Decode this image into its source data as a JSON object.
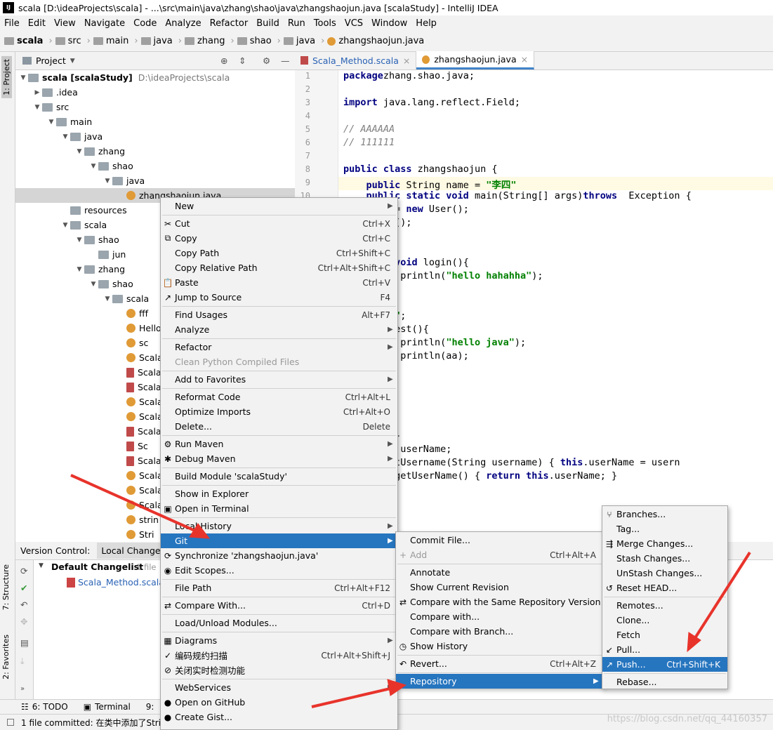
{
  "window": {
    "title": "scala [D:\\ideaProjects\\scala] - ...\\src\\main\\java\\zhang\\shao\\java\\zhangshaojun.java [scalaStudy] - IntelliJ IDEA"
  },
  "menubar": [
    "File",
    "Edit",
    "View",
    "Navigate",
    "Code",
    "Analyze",
    "Refactor",
    "Build",
    "Run",
    "Tools",
    "VCS",
    "Window",
    "Help"
  ],
  "breadcrumb": [
    "scala",
    "src",
    "main",
    "java",
    "zhang",
    "shao",
    "java",
    "zhangshaojun.java"
  ],
  "left_tools": {
    "project": "1: Project",
    "structure": "7: Structure",
    "favorites": "2: Favorites"
  },
  "project_panel": {
    "title": "Project",
    "tree": [
      {
        "label": "scala [scalaStudy]",
        "extra": "D:\\ideaProjects\\scala",
        "indent": 0,
        "chev": "down",
        "icon": "folder"
      },
      {
        "label": ".idea",
        "indent": 1,
        "chev": "right",
        "icon": "folder"
      },
      {
        "label": "src",
        "indent": 1,
        "chev": "down",
        "icon": "folder"
      },
      {
        "label": "main",
        "indent": 2,
        "chev": "down",
        "icon": "folder"
      },
      {
        "label": "java",
        "indent": 3,
        "chev": "down",
        "icon": "folder"
      },
      {
        "label": "zhang",
        "indent": 4,
        "chev": "down",
        "icon": "folder"
      },
      {
        "label": "shao",
        "indent": 5,
        "chev": "down",
        "icon": "folder"
      },
      {
        "label": "java",
        "indent": 6,
        "chev": "down",
        "icon": "folder"
      },
      {
        "label": "zhangshaojun.java",
        "indent": 7,
        "chev": "",
        "icon": "class",
        "selected": true
      },
      {
        "label": "resources",
        "indent": 3,
        "chev": "",
        "icon": "folder"
      },
      {
        "label": "scala",
        "indent": 3,
        "chev": "down",
        "icon": "folder"
      },
      {
        "label": "shao",
        "indent": 4,
        "chev": "down",
        "icon": "folder"
      },
      {
        "label": "jun",
        "indent": 5,
        "chev": "",
        "icon": "folder"
      },
      {
        "label": "zhang",
        "indent": 4,
        "chev": "down",
        "icon": "folder"
      },
      {
        "label": "shao",
        "indent": 5,
        "chev": "down",
        "icon": "folder"
      },
      {
        "label": "scala",
        "indent": 6,
        "chev": "down",
        "icon": "folder"
      },
      {
        "label": "fff",
        "indent": 7,
        "chev": "",
        "icon": "class"
      },
      {
        "label": "Hello",
        "indent": 7,
        "chev": "",
        "icon": "class"
      },
      {
        "label": "sc",
        "indent": 7,
        "chev": "",
        "icon": "class"
      },
      {
        "label": "Scala",
        "indent": 7,
        "chev": "",
        "icon": "class"
      },
      {
        "label": "Scala",
        "indent": 7,
        "chev": "",
        "icon": "file"
      },
      {
        "label": "Scala",
        "indent": 7,
        "chev": "",
        "icon": "file"
      },
      {
        "label": "Scala",
        "indent": 7,
        "chev": "",
        "icon": "class"
      },
      {
        "label": "Scala",
        "indent": 7,
        "chev": "",
        "icon": "class"
      },
      {
        "label": "Scala",
        "indent": 7,
        "chev": "",
        "icon": "file"
      },
      {
        "label": "Sc",
        "indent": 7,
        "chev": "",
        "icon": "file"
      },
      {
        "label": "Scala",
        "indent": 7,
        "chev": "",
        "icon": "file"
      },
      {
        "label": "Scala",
        "indent": 7,
        "chev": "",
        "icon": "class"
      },
      {
        "label": "Scala",
        "indent": 7,
        "chev": "",
        "icon": "class"
      },
      {
        "label": "Scala",
        "indent": 7,
        "chev": "",
        "icon": "class"
      },
      {
        "label": "strin",
        "indent": 7,
        "chev": "",
        "icon": "class"
      },
      {
        "label": "Stri",
        "indent": 7,
        "chev": "",
        "icon": "class"
      }
    ]
  },
  "editor": {
    "tabs": [
      {
        "label": "Scala_Method.scala",
        "active": false
      },
      {
        "label": "zhangshaojun.java",
        "active": true
      }
    ],
    "line_numbers": [
      "1",
      "2",
      "3",
      "4",
      "5",
      "6",
      "7",
      "8",
      "9",
      "10"
    ],
    "lines": [
      [
        [
          "kw",
          "package"
        ],
        [
          "",
          "zhang.shao.java;"
        ]
      ],
      [],
      [
        [
          "kw",
          "import"
        ],
        [
          "",
          " java.lang.reflect.Field;"
        ]
      ],
      [],
      [
        [
          "cmt",
          "// AAAAAA"
        ]
      ],
      [
        [
          "cmt",
          "// 111111"
        ]
      ],
      [],
      [
        [
          "kw",
          "public class"
        ],
        [
          "",
          " zhangshaojun {"
        ]
      ],
      [
        [
          "",
          ""
        ],
        [
          "kw",
          "    public"
        ],
        [
          "",
          " String name = "
        ],
        [
          "str",
          "\"李四\""
        ]
      ],
      [
        [
          "kw",
          "    public static void"
        ],
        [
          "",
          " main(String[] args)"
        ],
        [
          "kw",
          "throws"
        ],
        [
          "",
          "  Exception {"
        ]
      ],
      [
        [
          "",
          "ser user = "
        ],
        [
          "kw",
          "new"
        ],
        [
          "",
          " User();"
        ]
      ],
      [
        [
          "",
          "ser.clone();"
        ]
      ],
      [],
      [],
      [
        [
          "kw",
          "c static void"
        ],
        [
          "",
          " login(){"
        ]
      ],
      [
        [
          "",
          "ystem.out.println("
        ],
        [
          "str",
          "\"hello hahahha\""
        ],
        [
          "",
          ");"
        ]
      ],
      [],
      [],
      [
        [
          "",
          "g aa= "
        ],
        [
          "str",
          "\"10\""
        ],
        [
          "",
          ";"
        ]
      ],
      [
        [
          "kw",
          "c  void"
        ],
        [
          "",
          " test(){"
        ]
      ],
      [
        [
          "",
          "ystem.out.println("
        ],
        [
          "str",
          "\"hello java\""
        ],
        [
          "",
          ");"
        ]
      ],
      [
        [
          "",
          "ystem.out.println(aa);"
        ]
      ],
      [
        [
          "",
          "ogin();"
        ]
      ],
      [],
      [],
      [],
      [
        [
          "",
          "r{"
        ]
      ],
      [
        [
          "kw",
          "c"
        ],
        [
          "",
          " User(){}"
        ]
      ],
      [
        [
          "kw",
          "te"
        ],
        [
          "",
          " String userName;"
        ]
      ],
      [
        [
          "kw",
          "c void"
        ],
        [
          "",
          " setUsername(String username) { "
        ],
        [
          "kw",
          "this"
        ],
        [
          "",
          ".userName = usern"
        ]
      ],
      [
        [
          "kw",
          "c"
        ],
        [
          "",
          " String getUserName() { "
        ],
        [
          "kw",
          "return this"
        ],
        [
          "",
          ".userName; }"
        ]
      ],
      [],
      [
        [
          "",
          "ride"
        ]
      ]
    ]
  },
  "version_control": {
    "tab_label": "Version Control:",
    "local_changes": "Local Changes",
    "changelist": "Default Changelist",
    "changelist_count": "1 file",
    "file": "Scala_Method.scala"
  },
  "bottom_tabs": [
    "6: TODO",
    "Terminal",
    "9:"
  ],
  "status": "1 file committed: 在类中添加了Strin",
  "context_menu": [
    {
      "label": "New",
      "arrow": true
    },
    {
      "sep": true
    },
    {
      "label": "Cut",
      "shortcut": "Ctrl+X",
      "icon": "✂"
    },
    {
      "label": "Copy",
      "shortcut": "Ctrl+C",
      "icon": "⧉"
    },
    {
      "label": "Copy Path",
      "shortcut": "Ctrl+Shift+C"
    },
    {
      "label": "Copy Relative Path",
      "shortcut": "Ctrl+Alt+Shift+C"
    },
    {
      "label": "Paste",
      "shortcut": "Ctrl+V",
      "icon": "📋"
    },
    {
      "label": "Jump to Source",
      "shortcut": "F4",
      "icon": "↗"
    },
    {
      "sep": true
    },
    {
      "label": "Find Usages",
      "shortcut": "Alt+F7"
    },
    {
      "label": "Analyze",
      "arrow": true
    },
    {
      "sep": true
    },
    {
      "label": "Refactor",
      "arrow": true
    },
    {
      "label": "Clean Python Compiled Files",
      "disabled": true
    },
    {
      "sep": true
    },
    {
      "label": "Add to Favorites",
      "arrow": true
    },
    {
      "sep": true
    },
    {
      "label": "Reformat Code",
      "shortcut": "Ctrl+Alt+L"
    },
    {
      "label": "Optimize Imports",
      "shortcut": "Ctrl+Alt+O"
    },
    {
      "label": "Delete...",
      "shortcut": "Delete"
    },
    {
      "sep": true
    },
    {
      "label": "Run Maven",
      "arrow": true,
      "icon": "⚙"
    },
    {
      "label": "Debug Maven",
      "arrow": true,
      "icon": "✱"
    },
    {
      "sep": true
    },
    {
      "label": "Build Module 'scalaStudy'"
    },
    {
      "sep": true
    },
    {
      "label": "Show in Explorer"
    },
    {
      "label": "Open in Terminal",
      "icon": "▣"
    },
    {
      "sep": true
    },
    {
      "label": "Local History",
      "arrow": true
    },
    {
      "label": "Git",
      "arrow": true,
      "highlight": true
    },
    {
      "label": "Synchronize 'zhangshaojun.java'",
      "icon": "⟳"
    },
    {
      "label": "Edit Scopes...",
      "icon": "◉"
    },
    {
      "sep": true
    },
    {
      "label": "File Path",
      "shortcut": "Ctrl+Alt+F12"
    },
    {
      "sep": true
    },
    {
      "label": "Compare With...",
      "shortcut": "Ctrl+D",
      "icon": "⇄"
    },
    {
      "sep": true
    },
    {
      "label": "Load/Unload Modules..."
    },
    {
      "sep": true
    },
    {
      "label": "Diagrams",
      "arrow": true,
      "icon": "▦"
    },
    {
      "label": "编码规约扫描",
      "shortcut": "Ctrl+Alt+Shift+J",
      "icon": "✓"
    },
    {
      "label": "关闭实时检测功能",
      "icon": "⊘"
    },
    {
      "sep": true
    },
    {
      "label": "WebServices",
      "arrow": true
    },
    {
      "label": "Open on GitHub",
      "icon": "●"
    },
    {
      "label": "Create Gist...",
      "icon": "●"
    }
  ],
  "git_menu": [
    {
      "label": "Commit File..."
    },
    {
      "label": "Add",
      "shortcut": "Ctrl+Alt+A",
      "icon": "+",
      "disabled": true
    },
    {
      "sep": true
    },
    {
      "label": "Annotate"
    },
    {
      "label": "Show Current Revision"
    },
    {
      "label": "Compare with the Same Repository Version",
      "icon": "⇄"
    },
    {
      "label": "Compare with..."
    },
    {
      "label": "Compare with Branch..."
    },
    {
      "label": "Show History",
      "icon": "◷"
    },
    {
      "sep": true
    },
    {
      "label": "Revert...",
      "shortcut": "Ctrl+Alt+Z",
      "icon": "↶"
    },
    {
      "sep": true
    },
    {
      "label": "Repository",
      "arrow": true,
      "highlight": true
    }
  ],
  "repo_menu": [
    {
      "label": "Branches...",
      "icon": "⑂"
    },
    {
      "label": "Tag..."
    },
    {
      "label": "Merge Changes...",
      "icon": "⇶"
    },
    {
      "label": "Stash Changes..."
    },
    {
      "label": "UnStash Changes..."
    },
    {
      "label": "Reset HEAD...",
      "icon": "↺"
    },
    {
      "sep": true
    },
    {
      "label": "Remotes..."
    },
    {
      "label": "Clone..."
    },
    {
      "label": "Fetch"
    },
    {
      "label": "Pull...",
      "icon": "↙"
    },
    {
      "label": "Push...",
      "shortcut": "Ctrl+Shift+K",
      "icon": "↗",
      "highlight": true
    },
    {
      "sep": true
    },
    {
      "label": "Rebase..."
    }
  ],
  "watermark": "https://blog.csdn.net/qq_44160357",
  "colors": {
    "highlight": "#2675bf",
    "arrow": "#e8332b",
    "keyword": "#000080",
    "string": "#008000"
  }
}
